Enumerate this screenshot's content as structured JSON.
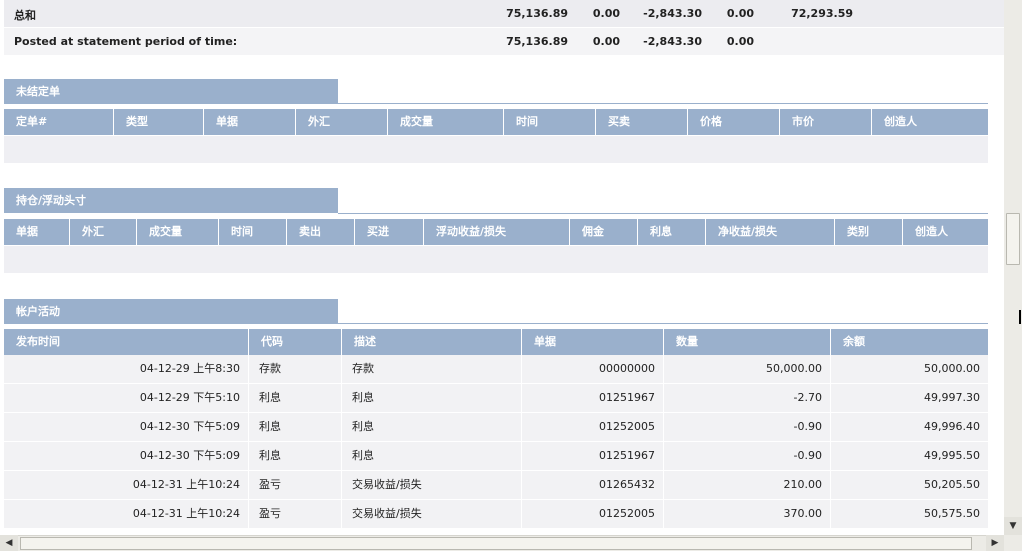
{
  "summary": {
    "total_label": "总和",
    "total_values": [
      "75,136.89",
      "0.00",
      "-2,843.30",
      "0.00",
      "72,293.59"
    ],
    "posted_label": "Posted at statement period of time:",
    "posted_values": [
      "75,136.89",
      "0.00",
      "-2,843.30",
      "0.00"
    ]
  },
  "pending_orders": {
    "title": "未结定单",
    "columns": [
      "定单#",
      "类型",
      "单据",
      "外汇",
      "成交量",
      "时间",
      "买卖",
      "价格",
      "市价",
      "创造人"
    ]
  },
  "open_positions": {
    "title": "持仓/浮动头寸",
    "columns": [
      "单据",
      "外汇",
      "成交量",
      "时间",
      "卖出",
      "买进",
      "浮动收益/损失",
      "佣金",
      "利息",
      "净收益/损失",
      "类别",
      "创造人"
    ]
  },
  "account_activity": {
    "title": "帐户活动",
    "columns": [
      "发布时间",
      "代码",
      "描述",
      "单据",
      "数量",
      "余额"
    ],
    "rows": [
      {
        "time": "04-12-29 上午8:30",
        "code": "存款",
        "desc": "存款",
        "ticket": "00000000",
        "amount": "50,000.00",
        "balance": "50,000.00"
      },
      {
        "time": "04-12-29 下午5:10",
        "code": "利息",
        "desc": "利息",
        "ticket": "01251967",
        "amount": "-2.70",
        "balance": "49,997.30"
      },
      {
        "time": "04-12-30 下午5:09",
        "code": "利息",
        "desc": "利息",
        "ticket": "01252005",
        "amount": "-0.90",
        "balance": "49,996.40"
      },
      {
        "time": "04-12-30 下午5:09",
        "code": "利息",
        "desc": "利息",
        "ticket": "01251967",
        "amount": "-0.90",
        "balance": "49,995.50"
      },
      {
        "time": "04-12-31 上午10:24",
        "code": "盈亏",
        "desc": "交易收益/损失",
        "ticket": "01265432",
        "amount": "210.00",
        "balance": "50,205.50"
      },
      {
        "time": "04-12-31 上午10:24",
        "code": "盈亏",
        "desc": "交易收益/损失",
        "ticket": "01252005",
        "amount": "370.00",
        "balance": "50,575.50"
      }
    ]
  },
  "scrollbar": {
    "up_arrow": "▲",
    "down_arrow": "▼",
    "left_arrow": "◀",
    "right_arrow": "▶"
  }
}
